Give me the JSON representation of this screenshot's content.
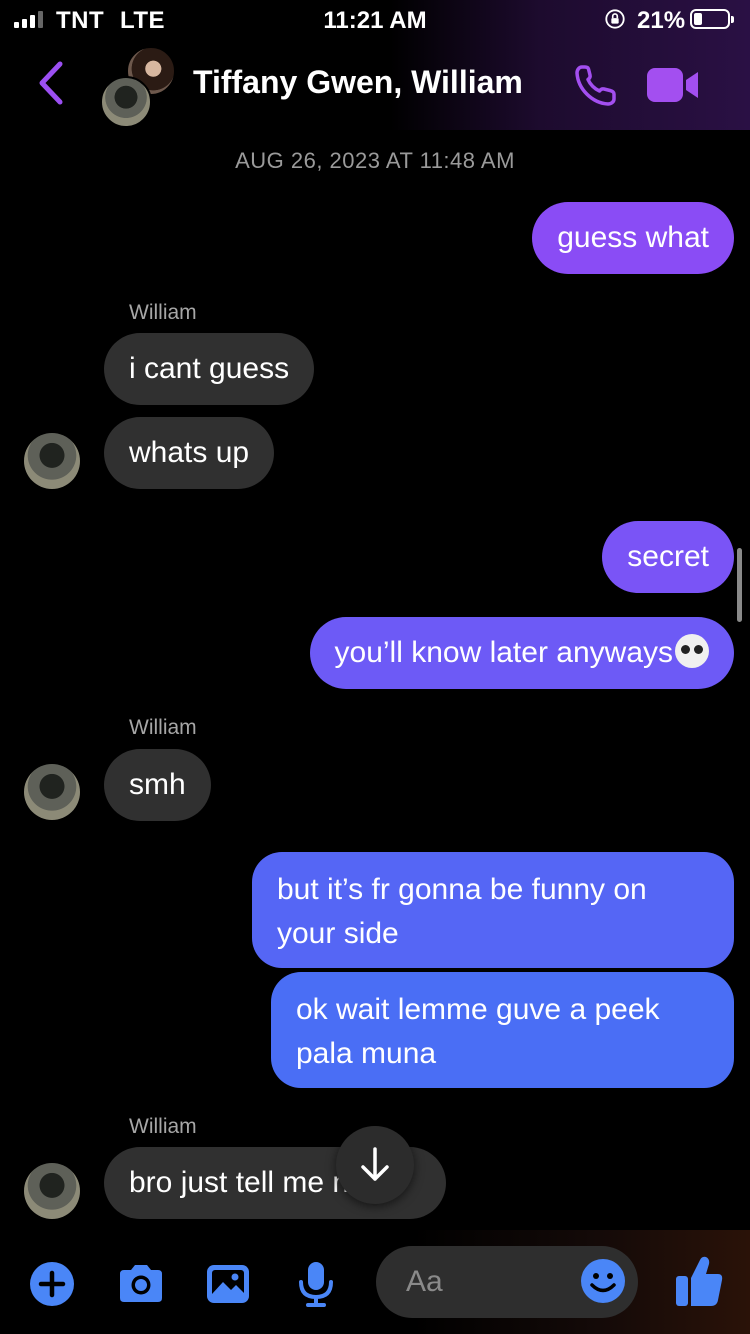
{
  "status_bar": {
    "carrier": "TNT",
    "network": "LTE",
    "time": "11:21 AM",
    "battery_percent": "21%"
  },
  "header": {
    "title": "Tiffany Gwen, William",
    "accent_color": "#a855f7"
  },
  "conversation": {
    "timestamp": "AUG 26, 2023 AT 11:48 AM",
    "messages": [
      {
        "from": "me",
        "text": "guess what"
      },
      {
        "from": "William",
        "sender_label": "William",
        "text": "i cant guess"
      },
      {
        "from": "William",
        "text": "whats up"
      },
      {
        "from": "me",
        "text": "secret"
      },
      {
        "from": "me",
        "text": "you’ll know later anyways",
        "emoji": "skull"
      },
      {
        "from": "William",
        "sender_label": "William",
        "text": "smh"
      },
      {
        "from": "me",
        "text": "but it’s fr gonna be funny on your side"
      },
      {
        "from": "me",
        "text": "ok wait lemme guve a peek pala muna"
      },
      {
        "from": "William",
        "sender_label": "William",
        "text": "bro just tell me now",
        "visible_text": "bro just tell me"
      }
    ]
  },
  "composer": {
    "placeholder": "Aa",
    "icons": [
      "plus-icon",
      "camera-icon",
      "image-icon",
      "microphone-icon",
      "emoji-icon",
      "thumbs-up-icon"
    ]
  },
  "colors": {
    "outgoing_top": "#8b4cf5",
    "outgoing_mid": "#6a5cf6",
    "outgoing_bottom": "#4a6ef5",
    "incoming": "#303030",
    "icon_blue": "#4a86f7"
  }
}
